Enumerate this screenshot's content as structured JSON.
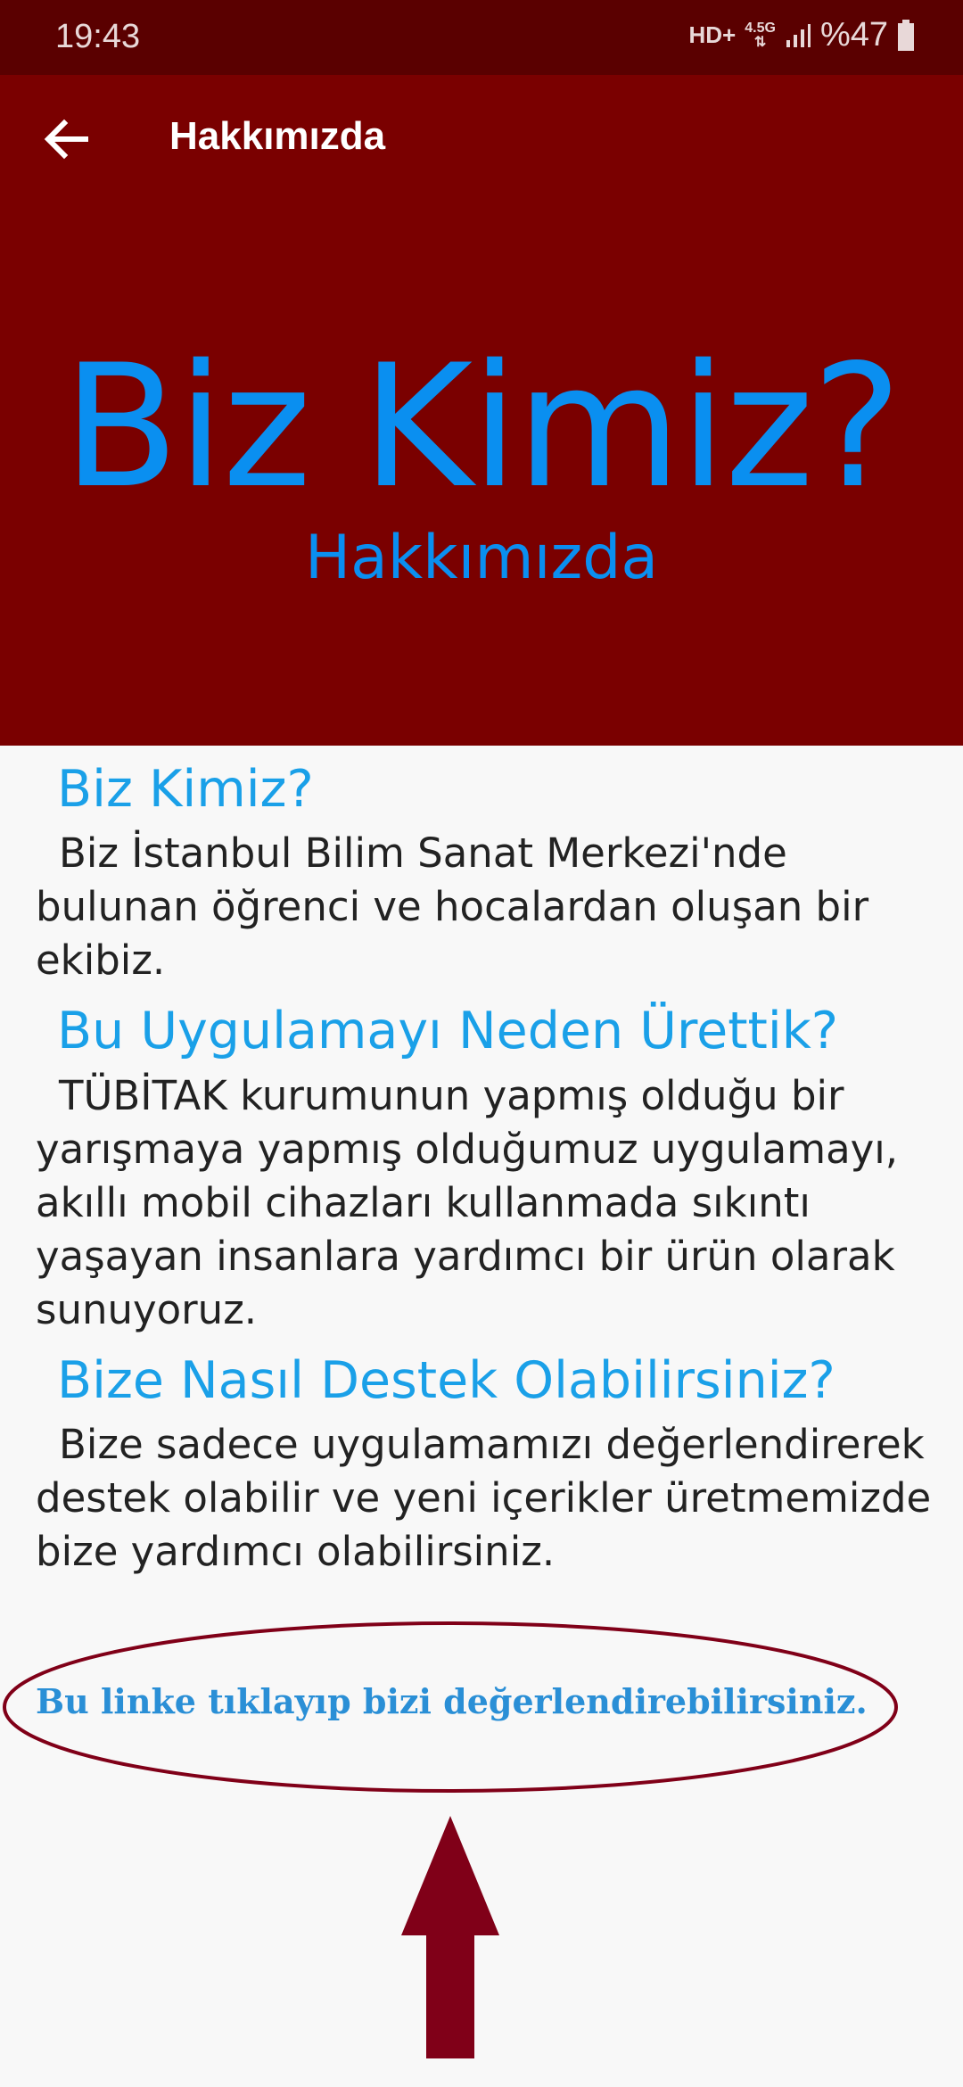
{
  "status_bar": {
    "time": "19:43",
    "network_type": "HD+",
    "network_gen": "4.5G",
    "battery": "%47"
  },
  "app_bar": {
    "title": "Hakkımızda"
  },
  "hero": {
    "title": "Biz Kimiz?",
    "subtitle": "Hakkımızda",
    "background": "#7a0000",
    "text_color": "#0a8ff0"
  },
  "sections": [
    {
      "heading": "Biz Kimiz?",
      "body": "Biz İstanbul Bilim Sanat Merkezi'nde bulunan öğrenci ve hocalardan oluşan bir ekibiz."
    },
    {
      "heading": "Bu Uygulamayı Neden Ürettik?",
      "body": "TÜBİTAK kurumunun yapmış olduğu bir yarışmaya yapmış olduğumuz uygulamayı, akıllı mobil cihazları kullanmada sıkıntı yaşayan insanlara yardımcı bir ürün olarak sunuyoruz."
    },
    {
      "heading": "Bize Nasıl Destek Olabilirsiniz?",
      "body": "Bize sadece uygulamamızı değerlendirerek destek olabilir ve yeni içerikler üretmemizde bize yardımcı olabilirsiniz."
    }
  ],
  "rate_link": "Bu linke tıklayıp bizi değerlendirebilirsiniz.",
  "colors": {
    "accent": "#1aa0e8",
    "annotation": "#800018"
  }
}
